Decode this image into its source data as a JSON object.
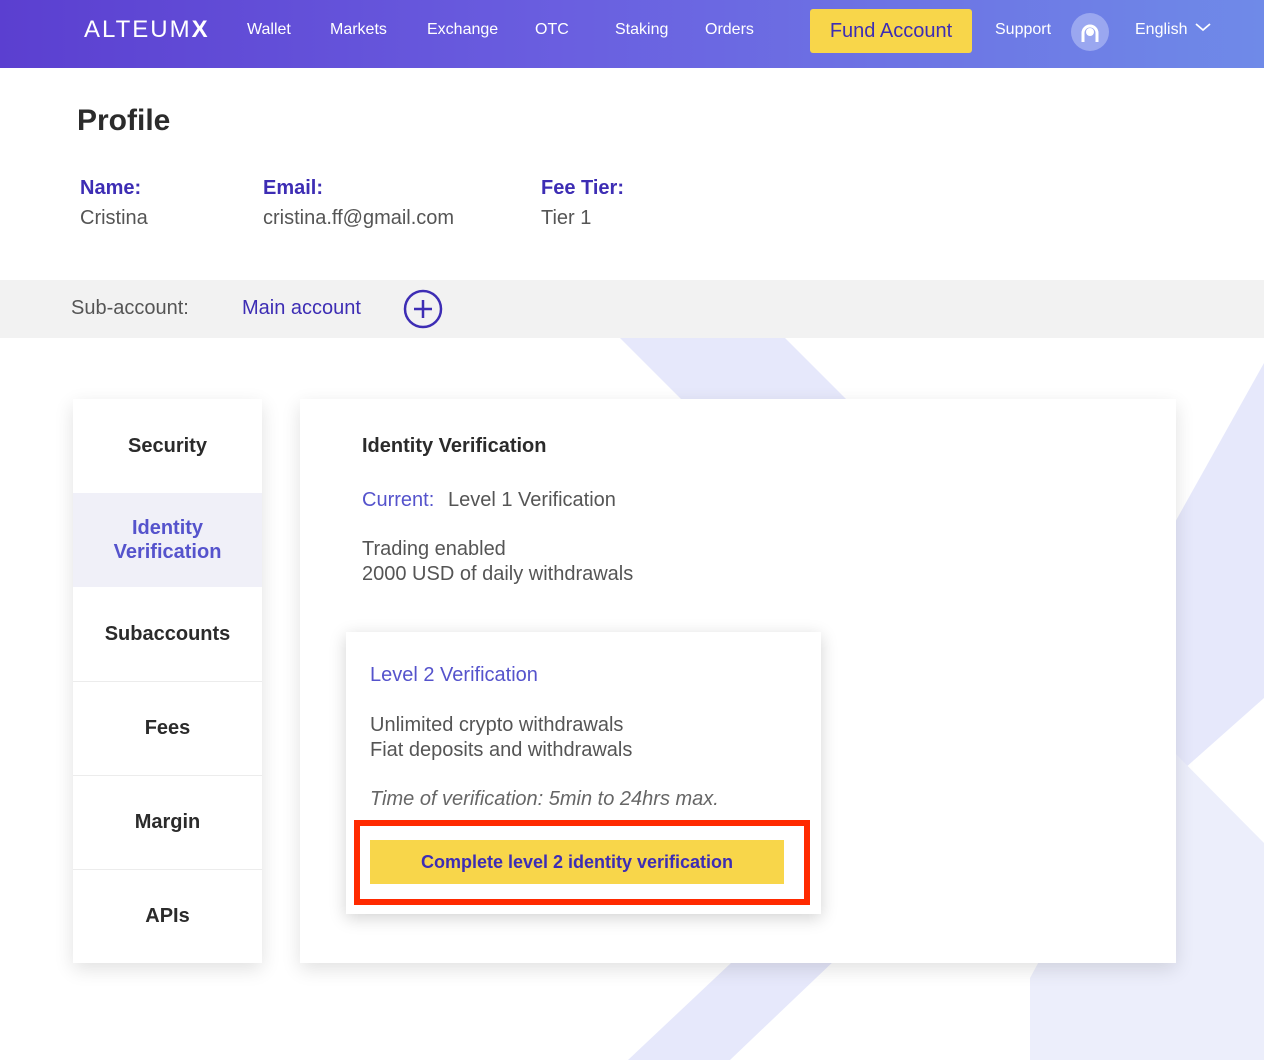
{
  "header": {
    "logo_light": "ALTEUM",
    "logo_bold": "X",
    "nav": [
      "Wallet",
      "Markets",
      "Exchange",
      "OTC",
      "Staking",
      "Orders"
    ],
    "fund_button": "Fund Account",
    "support": "Support",
    "language": "English"
  },
  "profile": {
    "title": "Profile",
    "name_label": "Name:",
    "name_value": "Cristina",
    "email_label": "Email:",
    "email_value": "cristina.ff@gmail.com",
    "fee_label": "Fee Tier:",
    "fee_value": "Tier 1"
  },
  "subaccount": {
    "label": "Sub-account:",
    "current": "Main account"
  },
  "sidebar": {
    "items": [
      {
        "label": "Security",
        "active": false
      },
      {
        "label": "Identity Verification",
        "active": true
      },
      {
        "label": "Subaccounts",
        "active": false
      },
      {
        "label": "Fees",
        "active": false
      },
      {
        "label": "Margin",
        "active": false
      },
      {
        "label": "APIs",
        "active": false
      }
    ]
  },
  "verification": {
    "title": "Identity Verification",
    "current_label": "Current",
    "current_value": "Level 1 Verification",
    "perks": [
      "Trading enabled",
      "2000 USD of daily withdrawals"
    ],
    "level2": {
      "title": "Level 2 Verification",
      "perks": [
        "Unlimited crypto withdrawals",
        "Fiat deposits and withdrawals"
      ],
      "time": "Time of verification: 5min to 24hrs max.",
      "button": "Complete level 2 identity verification"
    }
  },
  "colors": {
    "brand_purple": "#3d2db4",
    "accent_yellow": "#f8d64a",
    "highlight_red": "#ff2a00"
  }
}
